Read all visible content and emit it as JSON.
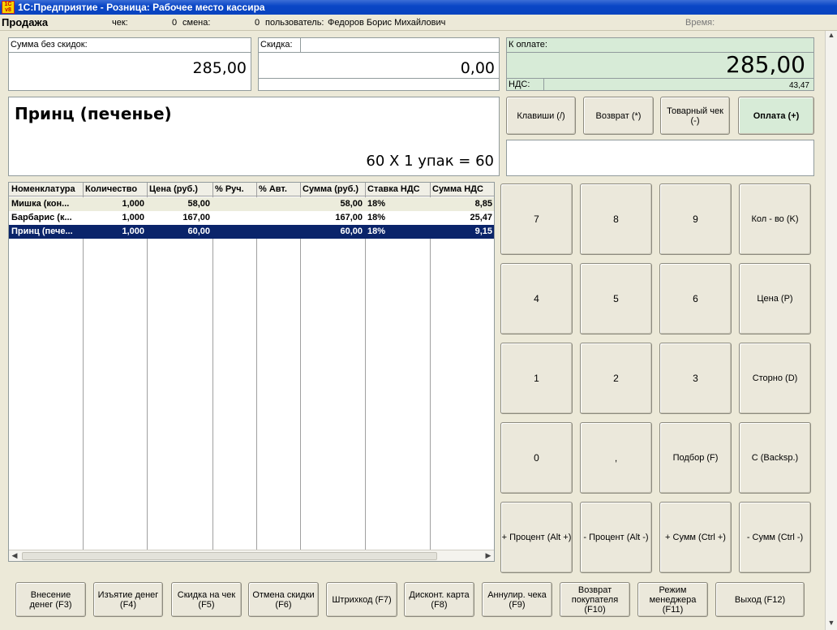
{
  "window": {
    "title": "1С:Предприятие - Розница: Рабочее место кассира",
    "logo": "1C v8"
  },
  "header": {
    "mode": "Продажа",
    "check_label": "чек:",
    "check_value": "0",
    "shift_label": "смена:",
    "shift_value": "0",
    "user_label": "пользователь:",
    "user_value": "Федоров Борис Михайлович",
    "time_label": "Время:"
  },
  "totals": {
    "sum_no_discount_label": "Сумма без скидок:",
    "sum_no_discount_value": "285,00",
    "discount_label": "Скидка:",
    "discount_value": "0,00",
    "to_pay_label": "К оплате:",
    "to_pay_value": "285,00",
    "vat_label": "НДС:",
    "vat_value": "43,47"
  },
  "product": {
    "name": "Принц (печенье)",
    "calc": "60 X 1 упак = 60"
  },
  "actions": {
    "keys": "Клавиши (/)",
    "return": "Возврат (*)",
    "receipt": "Товарный чек (-)",
    "pay": "Оплата (+)"
  },
  "table": {
    "columns": [
      "Номенклатура",
      "Количество",
      "Цена (руб.)",
      "% Руч.",
      "% Авт.",
      "Сумма (руб.)",
      "Ставка НДС",
      "Сумма НДС"
    ],
    "rows": [
      {
        "name": "Мишка (кон...",
        "qty": "1,000",
        "price": "58,00",
        "manual": "",
        "auto": "",
        "sum": "58,00",
        "vat_rate": "18%",
        "vat_sum": "8,85"
      },
      {
        "name": "Барбарис (к...",
        "qty": "1,000",
        "price": "167,00",
        "manual": "",
        "auto": "",
        "sum": "167,00",
        "vat_rate": "18%",
        "vat_sum": "25,47"
      },
      {
        "name": "Принц (пече...",
        "qty": "1,000",
        "price": "60,00",
        "manual": "",
        "auto": "",
        "sum": "60,00",
        "vat_rate": "18%",
        "vat_sum": "9,15"
      }
    ]
  },
  "keypad": {
    "k7": "7",
    "k8": "8",
    "k9": "9",
    "qty": "Кол - во (K)",
    "k4": "4",
    "k5": "5",
    "k6": "6",
    "price": "Цена (P)",
    "k1": "1",
    "k2": "2",
    "k3": "3",
    "storno": "Сторно (D)",
    "k0": "0",
    "comma": ",",
    "select": "Подбор (F)",
    "backsp": "C (Backsp.)",
    "plus_pct": "+ Процент (Alt +)",
    "minus_pct": "- Процент (Alt -)",
    "plus_sum": "+ Сумм (Ctrl +)",
    "minus_sum": "- Сумм (Ctrl -)"
  },
  "footer": {
    "b1": "Внесение денег (F3)",
    "b2": "Изъятие денег (F4)",
    "b3": "Скидка на чек (F5)",
    "b4": "Отмена скидки (F6)",
    "b5": "Штрихкод (F7)",
    "b6": "Дисконт. карта (F8)",
    "b7": "Аннулир. чека (F9)",
    "b8": "Возврат покупателя (F10)",
    "b9": "Режим менеджера (F11)",
    "b10": "Выход (F12)"
  },
  "colors": {
    "title_bar": "#0A46C6",
    "selected_row": "#0A246A",
    "pay_green": "#D7EBD7",
    "row_alt": "#ECECDC"
  }
}
